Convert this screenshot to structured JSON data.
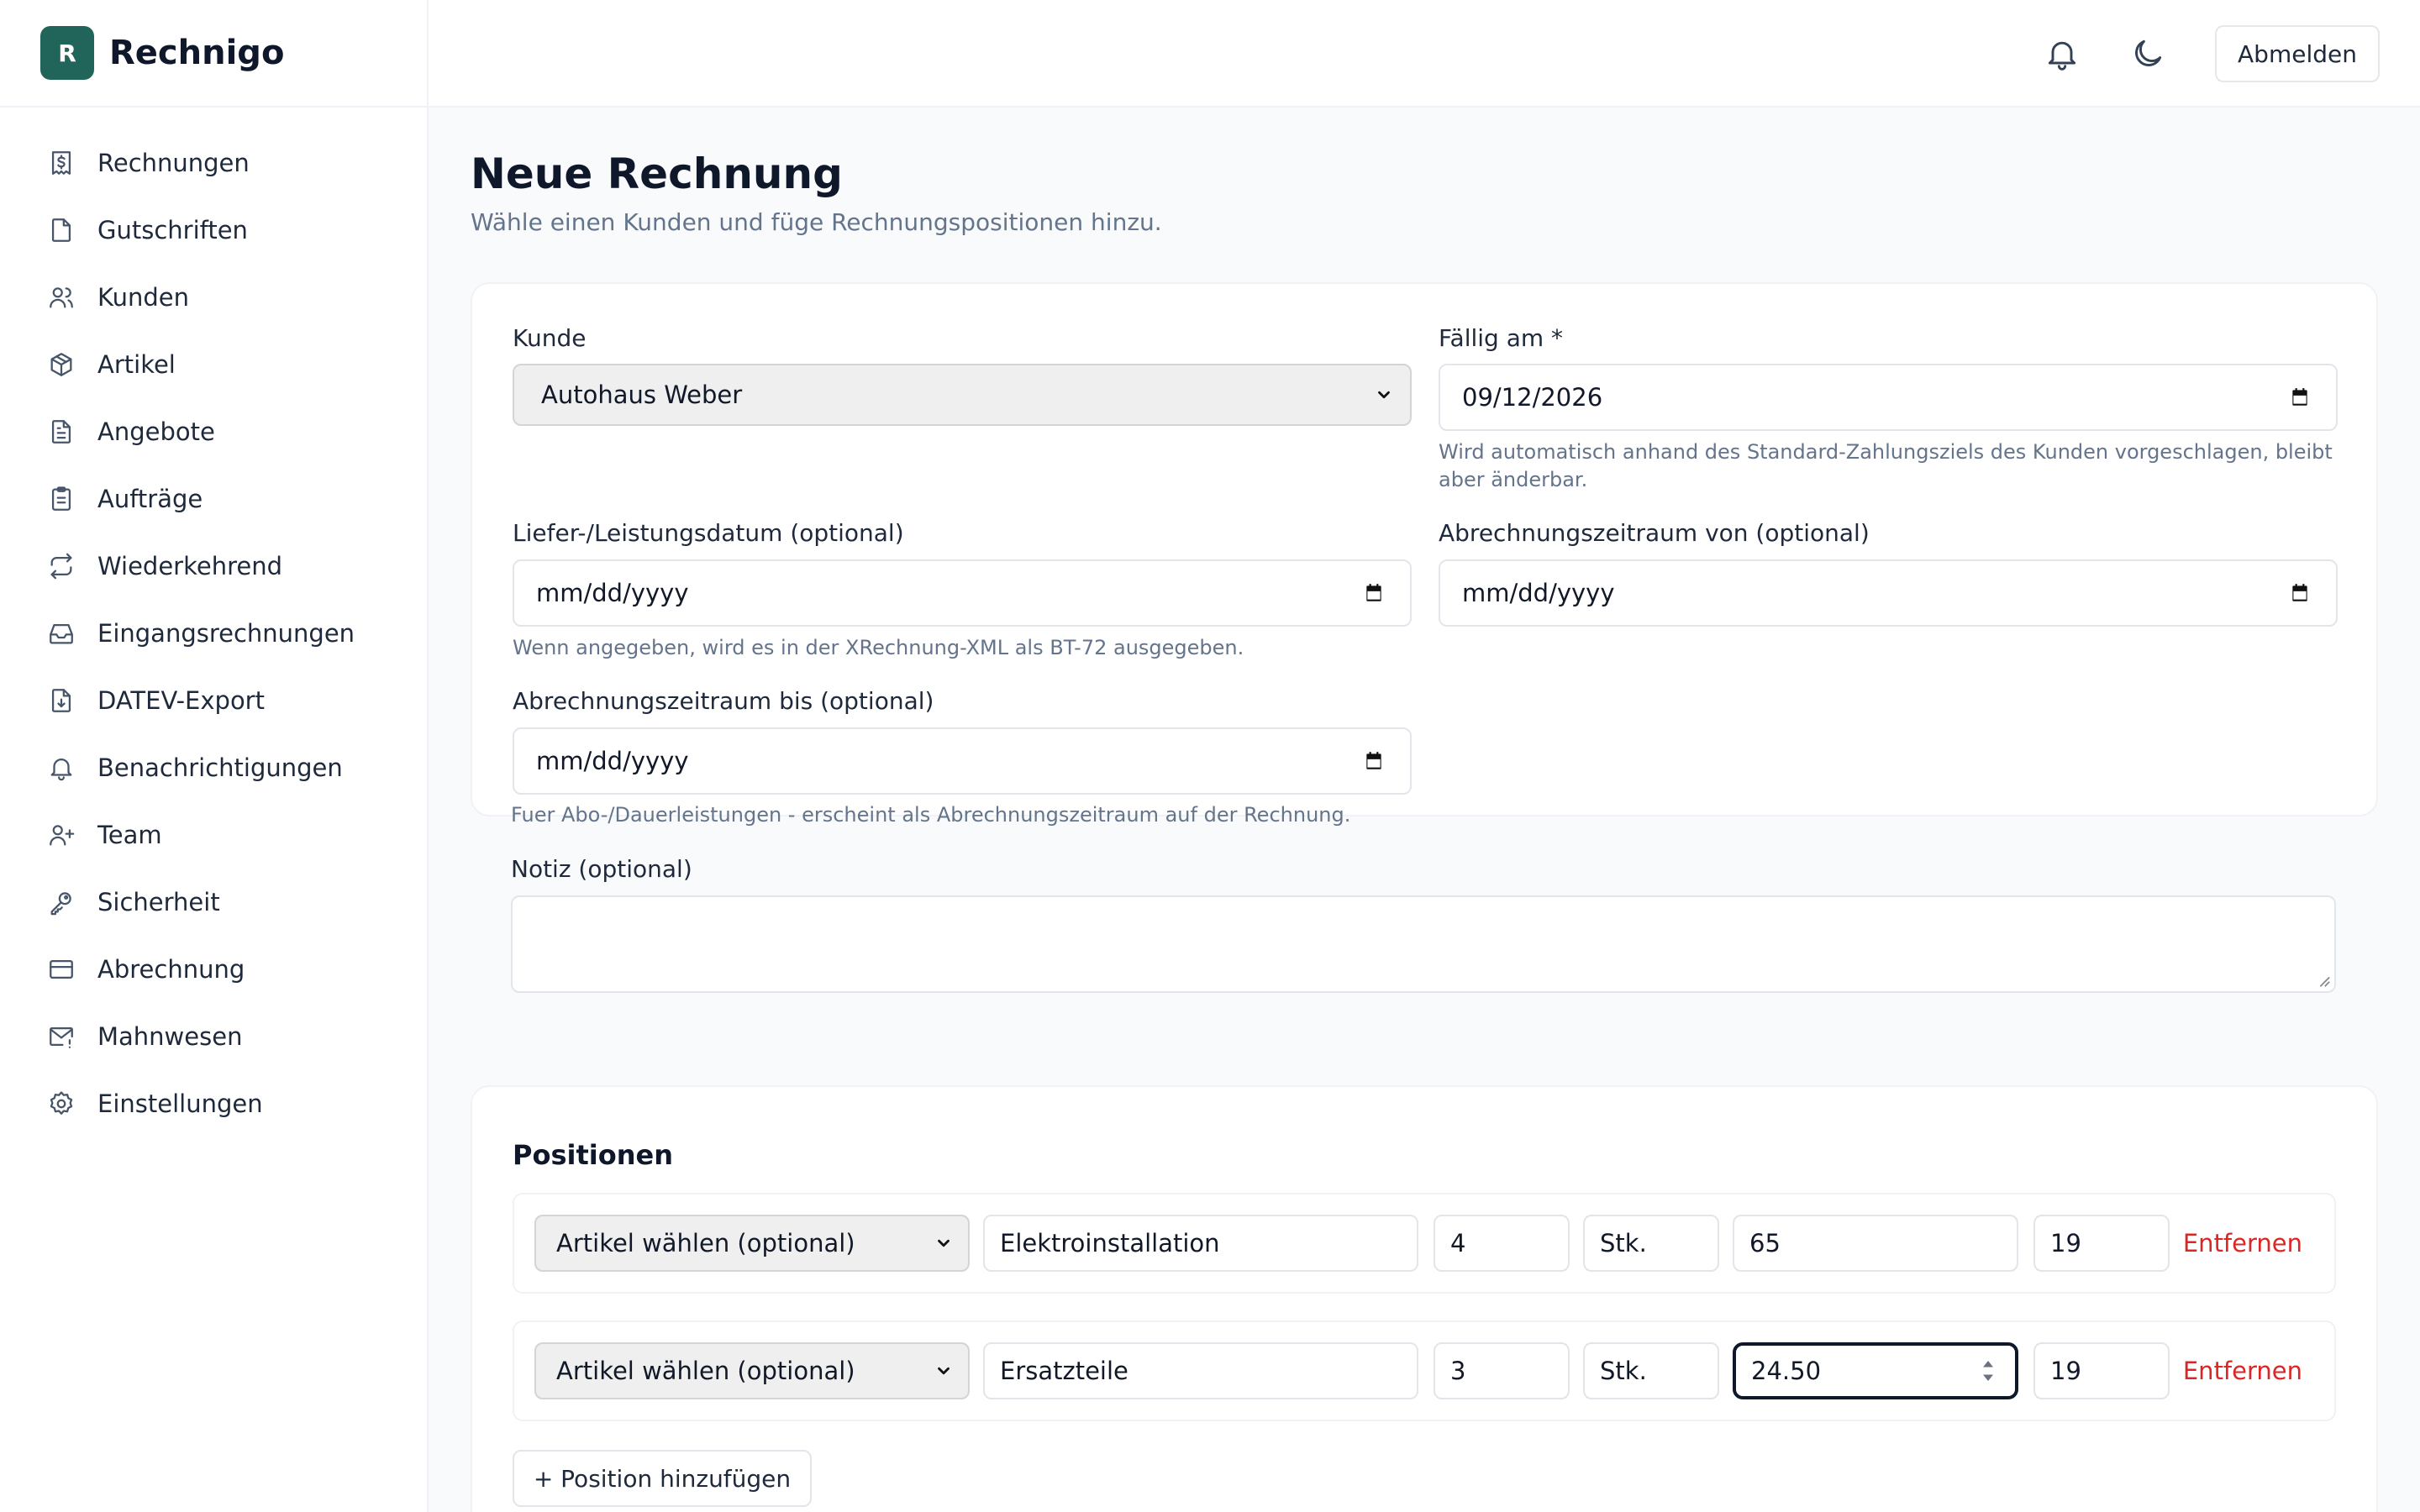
{
  "brand": {
    "logo_letter": "R",
    "name": "Rechnigo",
    "color": "#21655a"
  },
  "sidebar": {
    "items": [
      {
        "label": "Rechnungen",
        "icon": "receipt-dollar-icon"
      },
      {
        "label": "Gutschriften",
        "icon": "file-icon"
      },
      {
        "label": "Kunden",
        "icon": "users-icon"
      },
      {
        "label": "Artikel",
        "icon": "package-icon"
      },
      {
        "label": "Angebote",
        "icon": "file-text-icon"
      },
      {
        "label": "Aufträge",
        "icon": "clipboard-list-icon"
      },
      {
        "label": "Wiederkehrend",
        "icon": "repeat-icon"
      },
      {
        "label": "Eingangsrechnungen",
        "icon": "inbox-icon"
      },
      {
        "label": "DATEV-Export",
        "icon": "file-download-icon"
      },
      {
        "label": "Benachrichtigungen",
        "icon": "bell-icon"
      },
      {
        "label": "Team",
        "icon": "user-plus-icon"
      },
      {
        "label": "Sicherheit",
        "icon": "key-icon"
      },
      {
        "label": "Abrechnung",
        "icon": "credit-card-icon"
      },
      {
        "label": "Mahnwesen",
        "icon": "mail-alert-icon"
      },
      {
        "label": "Einstellungen",
        "icon": "gear-icon"
      }
    ]
  },
  "header": {
    "logout_label": "Abmelden"
  },
  "page": {
    "title": "Neue Rechnung",
    "subtitle": "Wähle einen Kunden und füge Rechnungspositionen hinzu."
  },
  "form": {
    "customer": {
      "label": "Kunde",
      "value": "Autohaus Weber"
    },
    "due": {
      "label": "Fällig am *",
      "value": "09/12/2026",
      "help": "Wird automatisch anhand des Standard-Zahlungsziels des Kunden vorgeschlagen, bleibt aber änderbar."
    },
    "delivery": {
      "label": "Liefer-/Leistungsdatum (optional)",
      "placeholder": "mm/dd/yyyy",
      "help": "Wenn angegeben, wird es in der XRechnung-XML als BT-72 ausgegeben."
    },
    "period_from": {
      "label": "Abrechnungszeitraum von (optional)",
      "placeholder": "mm/dd/yyyy"
    },
    "period_to": {
      "label": "Abrechnungszeitraum bis (optional)",
      "placeholder": "mm/dd/yyyy",
      "help": "Fuer Abo-/Dauerleistungen - erscheint als Abrechnungszeitraum auf der Rechnung."
    },
    "note": {
      "label": "Notiz (optional)",
      "value": ""
    }
  },
  "positions": {
    "title": "Positionen",
    "rows": [
      {
        "article": "Artikel wählen (optional)",
        "description": "Elektroinstallation",
        "qty": "4",
        "unit": "Stk.",
        "price": "65",
        "tax": "19",
        "remove": "Entfernen"
      },
      {
        "article": "Artikel wählen (optional)",
        "description": "Ersatzteile",
        "qty": "3",
        "unit": "Stk.",
        "price": "24.50",
        "tax": "19",
        "remove": "Entfernen"
      }
    ],
    "add_label": "+ Position hinzufügen"
  },
  "colors": {
    "danger": "#dc2626",
    "muted": "#64748b",
    "focus": "#0f172a"
  }
}
